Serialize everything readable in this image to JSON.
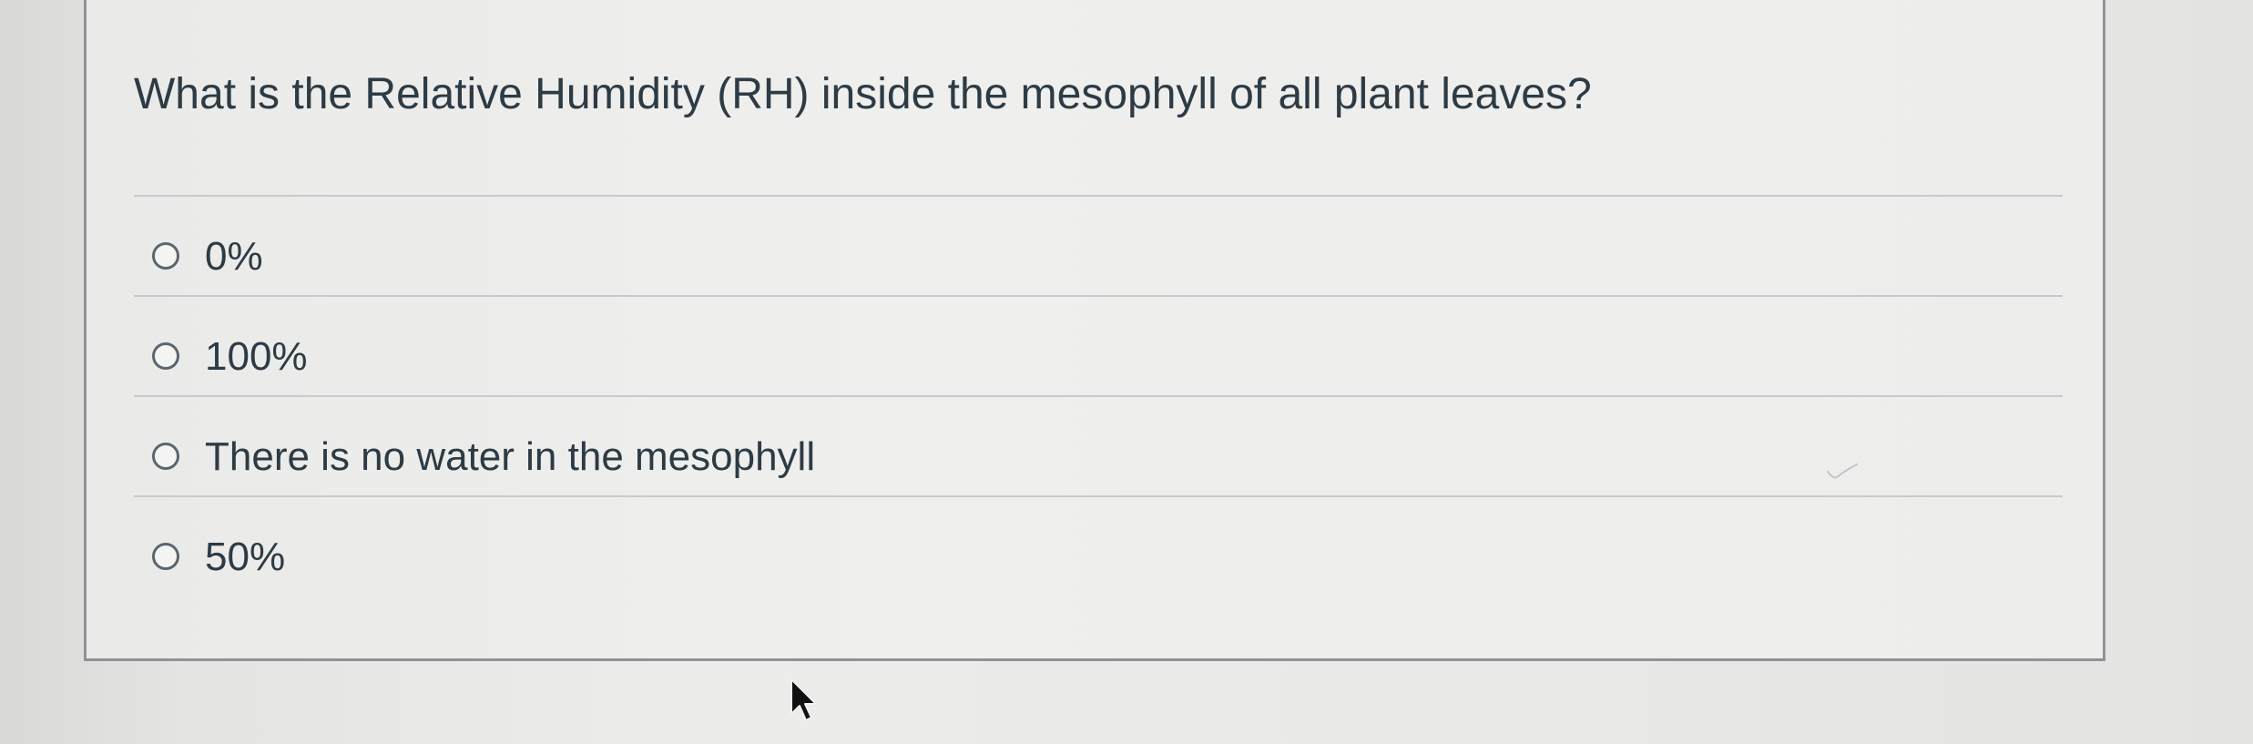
{
  "question": {
    "text": "What is the Relative Humidity (RH) inside the mesophyll of all plant leaves?"
  },
  "answers": [
    {
      "label": "0%",
      "selected": false
    },
    {
      "label": "100%",
      "selected": false
    },
    {
      "label": "There is no water in the mesophyll",
      "selected": false
    },
    {
      "label": "50%",
      "selected": false
    }
  ],
  "colors": {
    "text": "#2d3b45",
    "divider": "#c7cbce",
    "card_border": "#8f9396",
    "radio_border": "#5a6670"
  },
  "icons": {
    "cursor": "arrow-cursor-icon",
    "mark": "pencil-checkmark-icon"
  }
}
